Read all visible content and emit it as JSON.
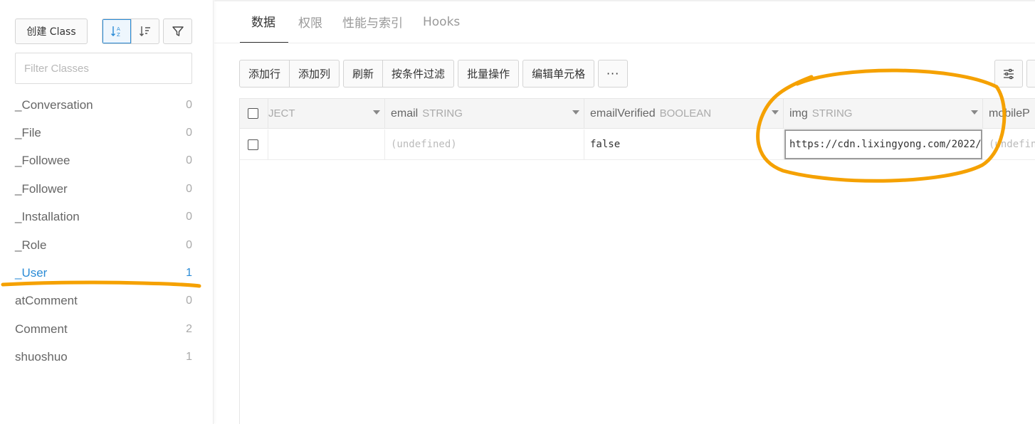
{
  "sidebar": {
    "create_label": "创建 Class",
    "filter_placeholder": "Filter Classes",
    "classes": [
      {
        "name": "_Conversation",
        "count": "0"
      },
      {
        "name": "_File",
        "count": "0"
      },
      {
        "name": "_Followee",
        "count": "0"
      },
      {
        "name": "_Follower",
        "count": "0"
      },
      {
        "name": "_Installation",
        "count": "0"
      },
      {
        "name": "_Role",
        "count": "0"
      },
      {
        "name": "_User",
        "count": "1"
      },
      {
        "name": "atComment",
        "count": "0"
      },
      {
        "name": "Comment",
        "count": "2"
      },
      {
        "name": "shuoshuo",
        "count": "1"
      }
    ],
    "active_class": "_User"
  },
  "tabs": [
    "数据",
    "权限",
    "性能与索引",
    "Hooks"
  ],
  "toolbar": {
    "add_row": "添加行",
    "add_column": "添加列",
    "refresh": "刷新",
    "filter_by_condition": "按条件过滤",
    "batch_ops": "批量操作",
    "edit_cell": "编辑单元格",
    "more": "···"
  },
  "table": {
    "columns": [
      {
        "name": "",
        "type": "JECT"
      },
      {
        "name": "email",
        "type": "STRING"
      },
      {
        "name": "emailVerified",
        "type": "BOOLEAN"
      },
      {
        "name": "img",
        "type": "STRING"
      },
      {
        "name": "mobileP",
        "type": ""
      }
    ],
    "row": {
      "email": "(undefined)",
      "emailVerified": "false",
      "img": "https://cdn.lixingyong.com/2022/",
      "mobile": "(undefin"
    }
  },
  "colors": {
    "accent": "#2a8bd6",
    "annotation": "#f5a100"
  },
  "icons": [
    "sort-alpha-icon",
    "sort-desc-icon",
    "filter-icon",
    "column-settings-icon",
    "dropdown-caret-icon"
  ]
}
